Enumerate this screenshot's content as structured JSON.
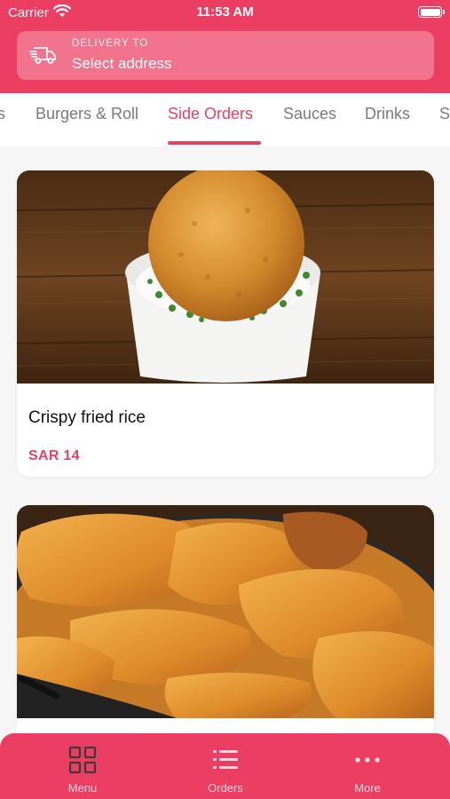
{
  "status_bar": {
    "carrier": "Carrier",
    "time": "11:53 AM"
  },
  "header": {
    "delivery_label": "DELIVERY TO",
    "address": "Select address"
  },
  "tabs": [
    {
      "label": "s"
    },
    {
      "label": "Burgers & Roll"
    },
    {
      "label": "Side Orders",
      "active": true
    },
    {
      "label": "Sauces"
    },
    {
      "label": "Drinks"
    },
    {
      "label": "S"
    }
  ],
  "items": [
    {
      "name": "Crispy fried rice",
      "price": "SAR 14",
      "image": "crispy-fried-rice-photo"
    },
    {
      "name": "",
      "price": "",
      "image": "potato-wedges-photo"
    }
  ],
  "bottom_nav": [
    {
      "label": "Menu",
      "icon": "grid-icon"
    },
    {
      "label": "Orders",
      "icon": "list-icon"
    },
    {
      "label": "More",
      "icon": "more-dots-icon"
    }
  ],
  "colors": {
    "brand": "#ec3d62",
    "accent_text": "#e94063"
  }
}
